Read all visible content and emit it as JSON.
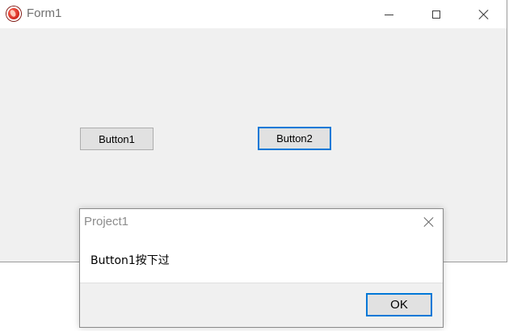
{
  "main_window": {
    "title": "Form1",
    "button1_label": "Button1",
    "button2_label": "Button2"
  },
  "dialog": {
    "title": "Project1",
    "message": "Button1按下过",
    "ok_label": "OK"
  },
  "colors": {
    "focus_border": "#0078d7",
    "window_background": "#f0f0f0",
    "button_face": "#e1e1e1"
  }
}
